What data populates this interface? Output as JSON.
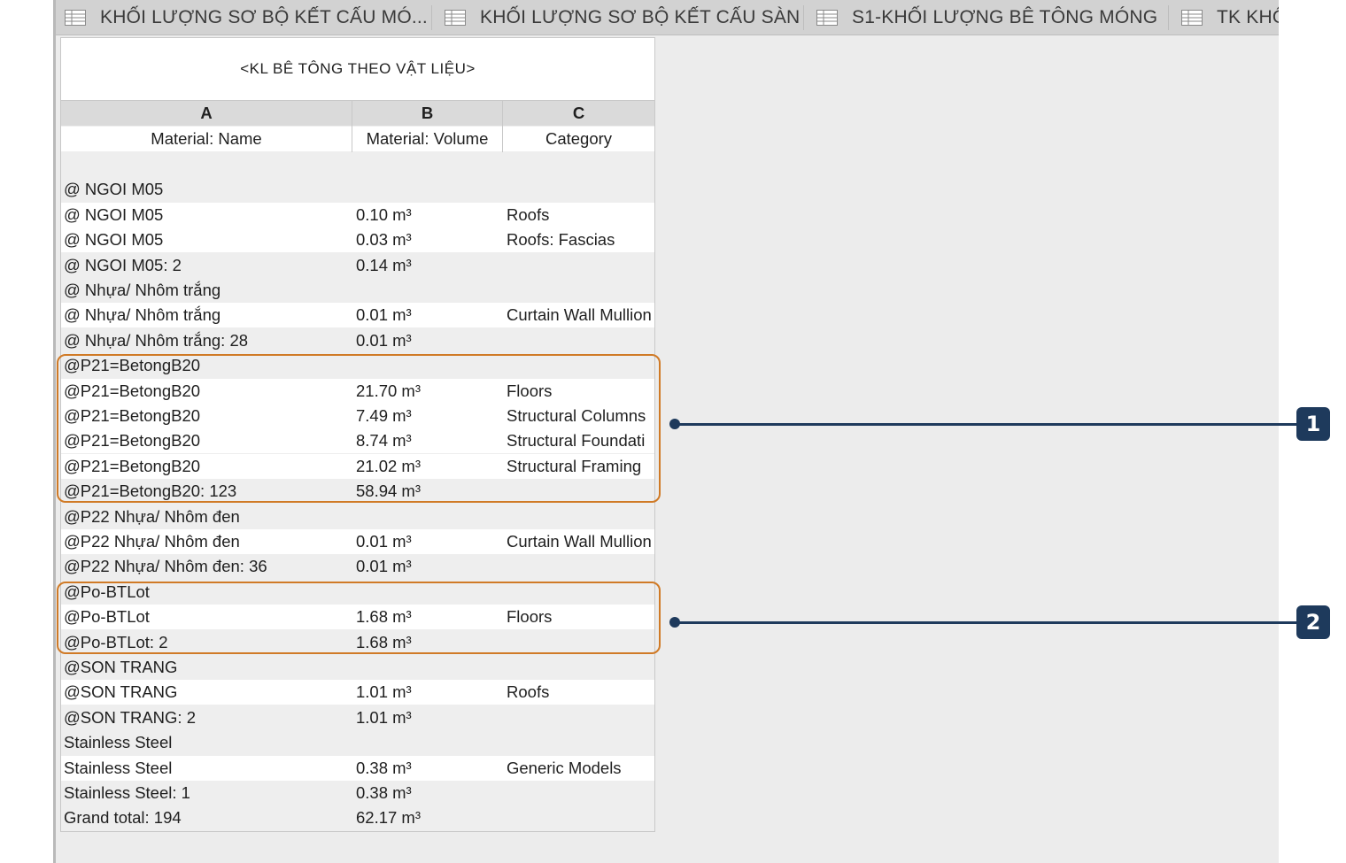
{
  "tabs": [
    {
      "label": "KHỐI LƯỢNG SƠ BỘ KẾT CẤU MÓ...",
      "icon": "schedule-icon"
    },
    {
      "label": "KHỐI LƯỢNG SƠ BỘ KẾT CẤU SÀN",
      "icon": "schedule-icon"
    },
    {
      "label": "S1-KHỐI LƯỢNG BÊ TÔNG MÓNG",
      "icon": "schedule-icon"
    },
    {
      "label": "TK KHỐ",
      "icon": "schedule-icon"
    }
  ],
  "schedule": {
    "title": "<KL BÊ TÔNG THEO VẬT LIỆU>",
    "column_letters": [
      "A",
      "B",
      "C"
    ],
    "column_headers": [
      "Material: Name",
      "Material: Volume",
      "Category"
    ],
    "rows": [
      {
        "a": "",
        "b": "",
        "c": ""
      },
      {
        "a": "@ NGOI M05",
        "b": "",
        "c": ""
      },
      {
        "a": "@ NGOI M05",
        "b": "0.10 m³",
        "c": "Roofs"
      },
      {
        "a": "@ NGOI M05",
        "b": "0.03 m³",
        "c": "Roofs: Fascias"
      },
      {
        "a": "@ NGOI M05: 2",
        "b": "0.14 m³",
        "c": ""
      },
      {
        "a": "@ Nhựa/ Nhôm trắng",
        "b": "",
        "c": ""
      },
      {
        "a": "@ Nhựa/ Nhôm trắng",
        "b": "0.01 m³",
        "c": "Curtain Wall Mullion"
      },
      {
        "a": "@ Nhựa/ Nhôm trắng: 28",
        "b": "0.01 m³",
        "c": ""
      },
      {
        "a": "@P21=BetongB20",
        "b": "",
        "c": ""
      },
      {
        "a": "@P21=BetongB20",
        "b": "21.70 m³",
        "c": "Floors"
      },
      {
        "a": "@P21=BetongB20",
        "b": "7.49 m³",
        "c": "Structural Columns"
      },
      {
        "a": "@P21=BetongB20",
        "b": "8.74 m³",
        "c": "Structural Foundati"
      },
      {
        "a": "@P21=BetongB20",
        "b": "21.02 m³",
        "c": "Structural Framing"
      },
      {
        "a": "@P21=BetongB20: 123",
        "b": "58.94 m³",
        "c": ""
      },
      {
        "a": "@P22 Nhựa/ Nhôm đen",
        "b": "",
        "c": ""
      },
      {
        "a": "@P22 Nhựa/ Nhôm đen",
        "b": "0.01 m³",
        "c": "Curtain Wall Mullion"
      },
      {
        "a": "@P22 Nhựa/ Nhôm đen: 36",
        "b": "0.01 m³",
        "c": ""
      },
      {
        "a": "@Po-BTLot",
        "b": "",
        "c": ""
      },
      {
        "a": "@Po-BTLot",
        "b": "1.68 m³",
        "c": "Floors"
      },
      {
        "a": "@Po-BTLot: 2",
        "b": "1.68 m³",
        "c": ""
      },
      {
        "a": "@SON TRANG",
        "b": "",
        "c": ""
      },
      {
        "a": "@SON TRANG",
        "b": "1.01 m³",
        "c": "Roofs"
      },
      {
        "a": "@SON TRANG: 2",
        "b": "1.01 m³",
        "c": ""
      },
      {
        "a": "Stainless Steel",
        "b": "",
        "c": ""
      },
      {
        "a": "Stainless Steel",
        "b": "0.38 m³",
        "c": "Generic Models"
      },
      {
        "a": "Stainless Steel: 1",
        "b": "0.38 m³",
        "c": ""
      },
      {
        "a": "Grand total: 194",
        "b": "62.17 m³",
        "c": ""
      }
    ]
  },
  "callouts": [
    "1",
    "2"
  ],
  "colors": {
    "highlight": "#d07a26",
    "callout": "#1e3a5c",
    "tab_bar": "#d2d2d2",
    "row_white": "#ffffff",
    "row_grey": "#eeeeee"
  }
}
